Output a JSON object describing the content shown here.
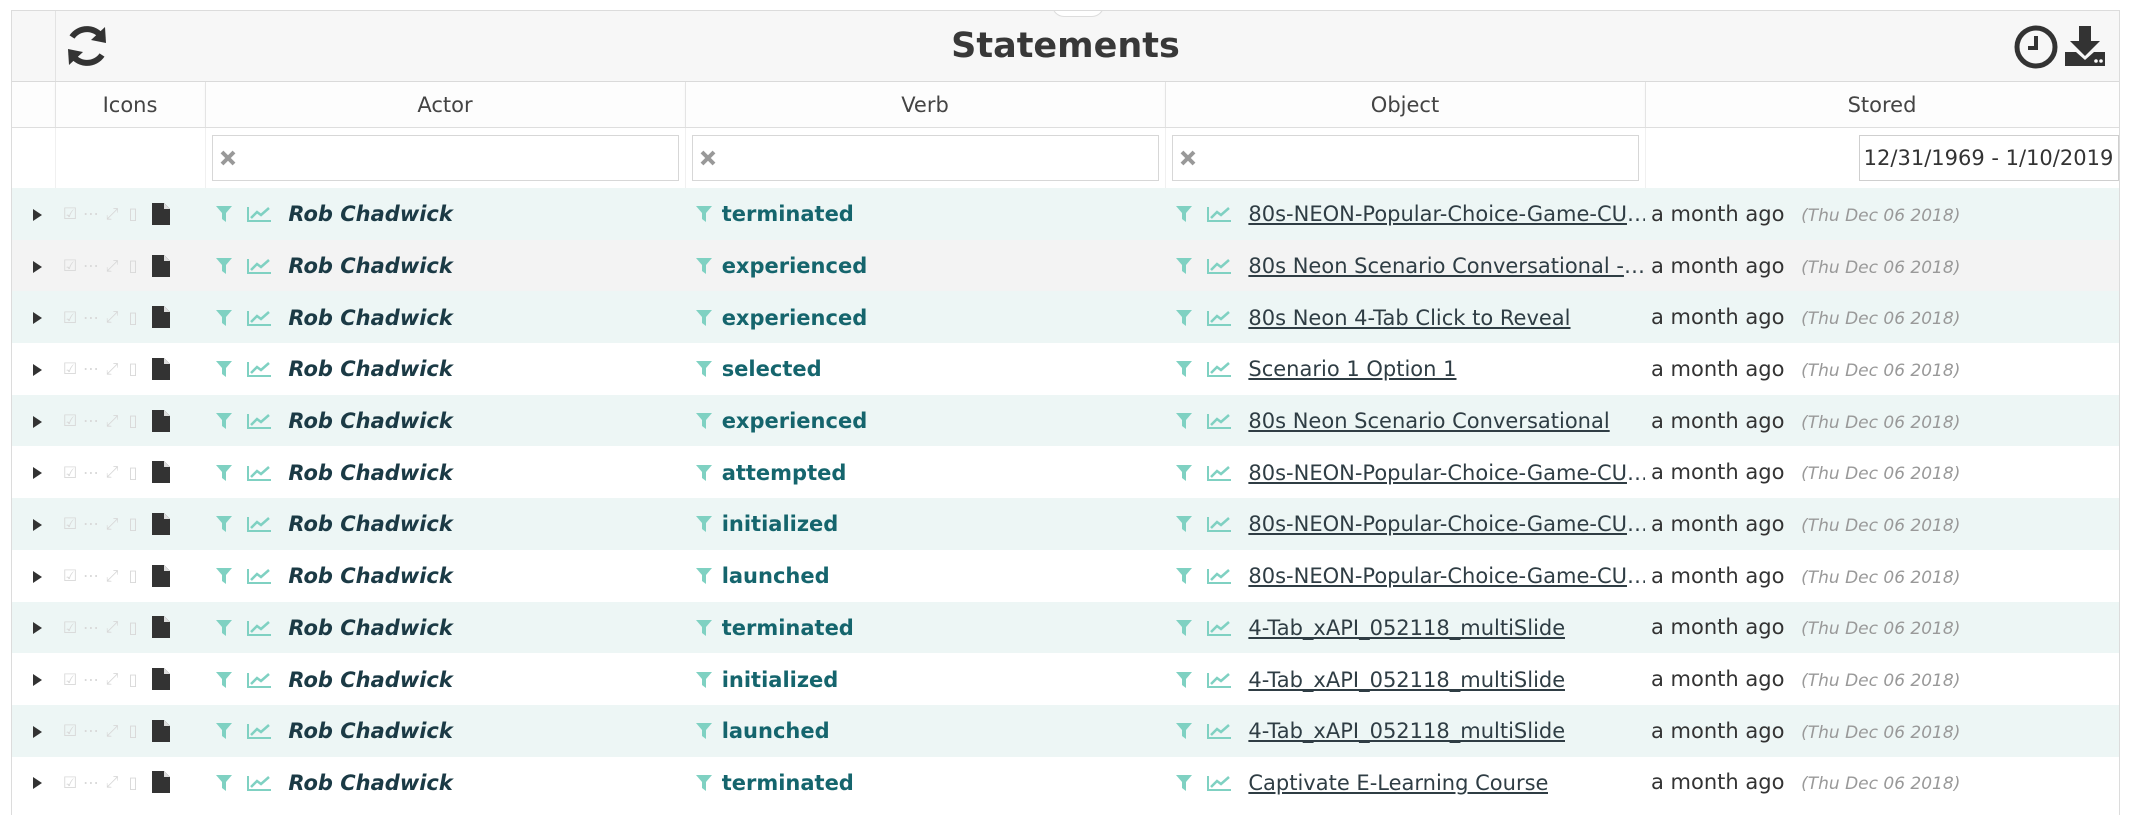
{
  "header": {
    "title": "Statements",
    "refresh_icon": "refresh-icon",
    "history_icon": "clock-icon",
    "download_icon": "download-icon"
  },
  "columns": {
    "icons": "Icons",
    "actor": "Actor",
    "verb": "Verb",
    "object": "Object",
    "stored": "Stored"
  },
  "filters": {
    "actor": "",
    "verb": "",
    "object": "",
    "stored_range": "12/31/1969 - 1/10/2019"
  },
  "colors": {
    "accent": "#15656d",
    "row_alt": "#edf6f5",
    "icon_teal": "#7fd1c2"
  },
  "rows": [
    {
      "actor": "Rob Chadwick",
      "verb": "terminated",
      "object": "80s-NEON-Popular-Choice-Game-CUST...",
      "ago": "a month ago",
      "date": "(Thu Dec 06 2018)"
    },
    {
      "actor": "Rob Chadwick",
      "verb": "experienced",
      "object": "80s Neon Scenario Conversational - Sce...",
      "ago": "a month ago",
      "date": "(Thu Dec 06 2018)"
    },
    {
      "actor": "Rob Chadwick",
      "verb": "experienced",
      "object": "80s Neon 4-Tab Click to Reveal",
      "ago": "a month ago",
      "date": "(Thu Dec 06 2018)"
    },
    {
      "actor": "Rob Chadwick",
      "verb": "selected",
      "object": "Scenario 1 Option 1",
      "ago": "a month ago",
      "date": "(Thu Dec 06 2018)"
    },
    {
      "actor": "Rob Chadwick",
      "verb": "experienced",
      "object": "80s Neon Scenario Conversational",
      "ago": "a month ago",
      "date": "(Thu Dec 06 2018)"
    },
    {
      "actor": "Rob Chadwick",
      "verb": "attempted",
      "object": "80s-NEON-Popular-Choice-Game-CUST...",
      "ago": "a month ago",
      "date": "(Thu Dec 06 2018)"
    },
    {
      "actor": "Rob Chadwick",
      "verb": "initialized",
      "object": "80s-NEON-Popular-Choice-Game-CUST...",
      "ago": "a month ago",
      "date": "(Thu Dec 06 2018)"
    },
    {
      "actor": "Rob Chadwick",
      "verb": "launched",
      "object": "80s-NEON-Popular-Choice-Game-CUST...",
      "ago": "a month ago",
      "date": "(Thu Dec 06 2018)"
    },
    {
      "actor": "Rob Chadwick",
      "verb": "terminated",
      "object": "4-Tab_xAPI_052118_multiSlide",
      "ago": "a month ago",
      "date": "(Thu Dec 06 2018)"
    },
    {
      "actor": "Rob Chadwick",
      "verb": "initialized",
      "object": "4-Tab_xAPI_052118_multiSlide",
      "ago": "a month ago",
      "date": "(Thu Dec 06 2018)"
    },
    {
      "actor": "Rob Chadwick",
      "verb": "launched",
      "object": "4-Tab_xAPI_052118_multiSlide",
      "ago": "a month ago",
      "date": "(Thu Dec 06 2018)"
    },
    {
      "actor": "Rob Chadwick",
      "verb": "terminated",
      "object": "Captivate E-Learning Course",
      "ago": "a month ago",
      "date": "(Thu Dec 06 2018)"
    }
  ]
}
